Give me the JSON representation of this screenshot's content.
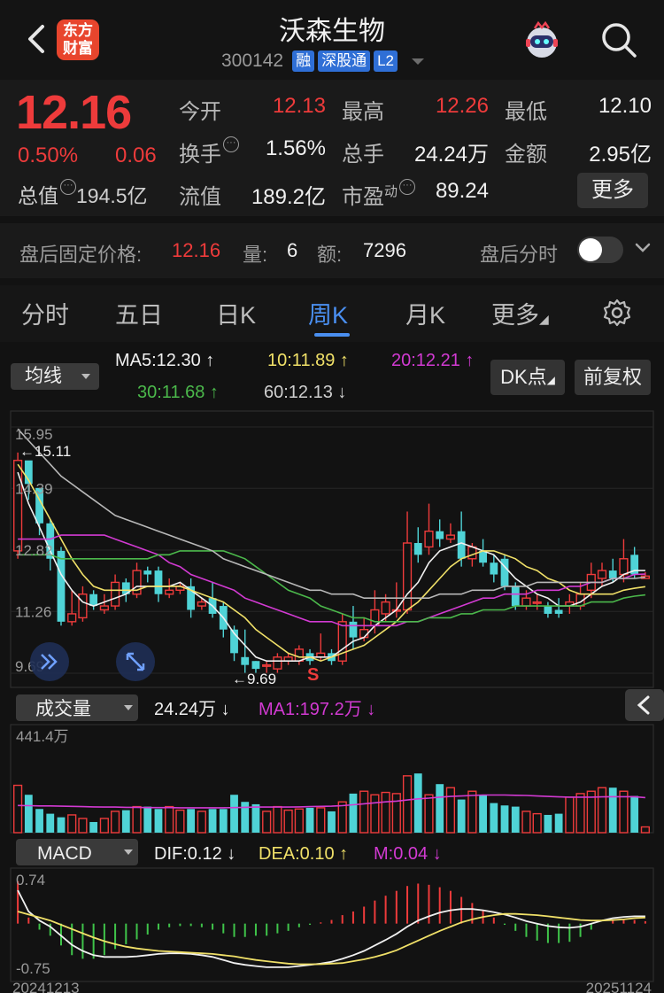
{
  "header": {
    "title": "沃森生物",
    "code": "300142",
    "badges": [
      "融",
      "深股通",
      "L2"
    ],
    "logo_line1": "东方",
    "logo_line2": "财富"
  },
  "quote": {
    "price": "12.16",
    "change_pct": "0.50%",
    "change": "0.06",
    "rows": [
      [
        {
          "label": "今开",
          "value": "12.13",
          "color": "red"
        },
        {
          "label": "最高",
          "value": "12.26",
          "color": "red"
        },
        {
          "label": "最低",
          "value": "12.10",
          "color": "white"
        }
      ],
      [
        {
          "label": "换手",
          "value": "1.56%",
          "color": "white"
        },
        {
          "label": "总手",
          "value": "24.24万",
          "color": "white"
        },
        {
          "label": "金额",
          "value": "2.95亿",
          "color": "white"
        }
      ],
      [
        {
          "label": "流值",
          "value": "189.2亿",
          "color": "white"
        },
        {
          "label": "市盈",
          "value": "89.24",
          "color": "white"
        }
      ]
    ],
    "total_mv_label": "总值",
    "total_mv_value": "194.5亿",
    "pe_superscript": "动",
    "more_label": "更多"
  },
  "after_hours": {
    "label": "盘后固定价格:",
    "price": "12.16",
    "vol_label": "量:",
    "vol": "6",
    "amt_label": "额:",
    "amt": "7296",
    "timeshare_label": "盘后分时"
  },
  "tabs": [
    "分时",
    "五日",
    "日K",
    "周K",
    "月K",
    "更多"
  ],
  "active_tab": "周K",
  "indicators": {
    "ma_selector": "均线",
    "ma5": "MA5:12.30 ↑",
    "ma10": "10:11.89 ↑",
    "ma20": "20:12.21 ↑",
    "ma30": "30:11.68 ↑",
    "ma60": "60:12.13 ↓",
    "dk_label": "DK点",
    "fq_label": "前复权",
    "vol_selector": "成交量",
    "vol_value": "24.24万 ↓",
    "vol_ma1": "MA1:197.2万 ↓",
    "macd_selector": "MACD",
    "dif": "DIF:0.12 ↓",
    "dea": "DEA:0.10 ↑",
    "m": "M:0.04 ↓"
  },
  "colors": {
    "up": "#ee3b3b",
    "down": "#4fd3d6",
    "ma5": "#f0f0f0",
    "ma10": "#f0e068",
    "ma20": "#d23ad2",
    "ma30": "#4bb84b",
    "ma60": "#b8b8b8",
    "accent": "#4a8ff0"
  },
  "chart_data": [
    {
      "type": "candlestick",
      "title": "",
      "y_tick_labels": [
        "15.95",
        "14.39",
        "12.82",
        "11.26",
        "9.69"
      ],
      "ylim": [
        9.69,
        15.95
      ],
      "annotations": [
        "←15.11",
        "←9.69",
        "S"
      ],
      "candles": [
        [
          12.8,
          15.1,
          15.3,
          12.6
        ],
        [
          15.1,
          14.5,
          15.0,
          14.1
        ],
        [
          14.4,
          13.5,
          14.4,
          13.2
        ],
        [
          13.5,
          12.6,
          13.6,
          12.3
        ],
        [
          12.8,
          11.0,
          12.9,
          10.9
        ],
        [
          11.0,
          11.2,
          11.8,
          10.9
        ],
        [
          11.1,
          11.7,
          11.9,
          11.0
        ],
        [
          11.7,
          11.4,
          11.8,
          11.3
        ],
        [
          11.3,
          11.4,
          11.7,
          11.2
        ],
        [
          11.4,
          12.0,
          12.2,
          11.3
        ],
        [
          12.0,
          11.7,
          12.1,
          11.5
        ],
        [
          11.7,
          12.3,
          12.5,
          11.6
        ],
        [
          12.3,
          12.2,
          12.4,
          12.0
        ],
        [
          12.3,
          11.7,
          12.4,
          11.5
        ],
        [
          11.7,
          11.8,
          12.1,
          11.6
        ],
        [
          11.8,
          11.9,
          12.0,
          11.7
        ],
        [
          11.9,
          11.3,
          12.1,
          11.1
        ],
        [
          11.4,
          11.5,
          11.6,
          11.3
        ],
        [
          11.6,
          11.2,
          12.0,
          11.1
        ],
        [
          11.4,
          10.8,
          11.5,
          10.6
        ],
        [
          10.8,
          10.2,
          10.9,
          10.0
        ],
        [
          10.1,
          9.9,
          10.8,
          9.7
        ],
        [
          10.0,
          9.8,
          10.0,
          9.7
        ],
        [
          9.9,
          9.9,
          10.0,
          9.7
        ],
        [
          9.8,
          10.1,
          10.2,
          9.7
        ],
        [
          10.0,
          10.1,
          10.2,
          9.9
        ],
        [
          10.0,
          10.3,
          10.4,
          9.9
        ],
        [
          10.2,
          10.0,
          10.3,
          9.9
        ],
        [
          10.1,
          10.2,
          10.7,
          10.0
        ],
        [
          10.2,
          10.0,
          10.3,
          9.9
        ],
        [
          10.0,
          11.0,
          11.2,
          9.9
        ],
        [
          11.0,
          10.6,
          11.4,
          10.3
        ],
        [
          10.6,
          10.8,
          11.1,
          10.5
        ],
        [
          10.9,
          11.3,
          11.8,
          10.7
        ],
        [
          11.2,
          11.5,
          11.7,
          11.0
        ],
        [
          11.3,
          11.3,
          12.0,
          11.1
        ],
        [
          11.3,
          13.0,
          13.8,
          11.2
        ],
        [
          13.0,
          12.7,
          13.4,
          12.5
        ],
        [
          12.9,
          13.3,
          14.0,
          12.7
        ],
        [
          13.3,
          13.1,
          13.6,
          12.9
        ],
        [
          13.1,
          13.2,
          13.5,
          13.0
        ],
        [
          13.3,
          12.6,
          13.8,
          12.4
        ],
        [
          12.6,
          12.9,
          13.0,
          12.4
        ],
        [
          12.8,
          12.5,
          13.1,
          12.4
        ],
        [
          12.5,
          12.2,
          12.7,
          12.0
        ],
        [
          12.6,
          11.9,
          12.7,
          11.8
        ],
        [
          11.9,
          11.4,
          12.0,
          11.3
        ],
        [
          11.4,
          11.6,
          11.8,
          11.3
        ],
        [
          11.5,
          11.5,
          11.7,
          11.3
        ],
        [
          11.4,
          11.2,
          11.5,
          11.1
        ],
        [
          11.3,
          11.2,
          11.6,
          11.1
        ],
        [
          11.4,
          11.5,
          11.7,
          11.2
        ],
        [
          11.4,
          11.7,
          12.0,
          11.3
        ],
        [
          11.8,
          12.2,
          12.5,
          11.6
        ],
        [
          12.1,
          12.3,
          12.5,
          11.9
        ],
        [
          12.3,
          12.1,
          12.6,
          12.0
        ],
        [
          12.2,
          12.6,
          13.1,
          12.0
        ],
        [
          12.7,
          12.2,
          12.9,
          12.1
        ],
        [
          12.1,
          12.16,
          12.26,
          12.1
        ]
      ],
      "ma_lines": {
        "MA5": [
          14.8,
          14.0,
          13.4,
          12.8,
          12.2,
          11.8,
          11.5,
          11.4,
          11.5,
          11.6,
          11.7,
          11.9,
          11.9,
          11.9,
          11.9,
          12.0,
          11.8,
          11.6,
          11.4,
          11.1,
          10.7,
          10.4,
          10.1,
          10.0,
          10.0,
          10.0,
          10.0,
          10.1,
          10.1,
          10.1,
          10.3,
          10.5,
          10.6,
          10.9,
          11.1,
          11.3,
          11.7,
          12.0,
          12.5,
          12.8,
          12.9,
          13.0,
          12.9,
          12.8,
          12.7,
          12.4,
          12.1,
          11.9,
          11.7,
          11.6,
          11.4,
          11.4,
          11.5,
          11.7,
          11.9,
          12.0,
          12.2,
          12.3,
          12.3
        ],
        "MA10": [
          15.0,
          14.6,
          14.1,
          13.6,
          13.1,
          12.6,
          12.2,
          11.9,
          11.8,
          11.8,
          11.8,
          11.8,
          11.9,
          11.9,
          11.9,
          11.9,
          11.8,
          11.7,
          11.6,
          11.5,
          11.3,
          11.1,
          10.8,
          10.6,
          10.4,
          10.2,
          10.1,
          10.1,
          10.0,
          10.1,
          10.2,
          10.3,
          10.4,
          10.6,
          10.8,
          11.0,
          11.3,
          11.5,
          11.8,
          12.1,
          12.4,
          12.6,
          12.7,
          12.8,
          12.8,
          12.7,
          12.6,
          12.4,
          12.3,
          12.1,
          12.0,
          11.8,
          11.7,
          11.7,
          11.7,
          11.7,
          11.8,
          11.85,
          11.89
        ],
        "MA20": [
          13.1,
          13.1,
          13.1,
          13.1,
          13.2,
          13.2,
          13.2,
          13.2,
          13.2,
          13.1,
          13.0,
          12.9,
          12.8,
          12.7,
          12.5,
          12.4,
          12.2,
          12.1,
          12.0,
          11.9,
          11.8,
          11.6,
          11.5,
          11.4,
          11.3,
          11.2,
          11.1,
          11.0,
          11.0,
          11.0,
          10.9,
          10.9,
          10.9,
          10.9,
          10.9,
          10.9,
          11.0,
          11.0,
          11.1,
          11.2,
          11.3,
          11.4,
          11.5,
          11.6,
          11.6,
          11.7,
          11.7,
          11.7,
          11.8,
          11.8,
          11.8,
          11.9,
          11.9,
          12.0,
          12.0,
          12.1,
          12.1,
          12.2,
          12.21
        ],
        "MA30": [
          12.7,
          12.7,
          12.7,
          12.7,
          12.6,
          12.6,
          12.6,
          12.6,
          12.6,
          12.6,
          12.6,
          12.6,
          12.6,
          12.7,
          12.7,
          12.8,
          12.8,
          12.8,
          12.8,
          12.8,
          12.7,
          12.6,
          12.4,
          12.2,
          12.0,
          11.8,
          11.7,
          11.6,
          11.4,
          11.3,
          11.2,
          11.1,
          11.1,
          11.0,
          11.0,
          11.0,
          11.0,
          11.0,
          11.1,
          11.1,
          11.1,
          11.2,
          11.2,
          11.3,
          11.3,
          11.3,
          11.4,
          11.4,
          11.4,
          11.4,
          11.4,
          11.4,
          11.4,
          11.5,
          11.5,
          11.5,
          11.6,
          11.65,
          11.68
        ],
        "MA60": [
          15.9,
          15.6,
          15.3,
          15.0,
          14.7,
          14.5,
          14.3,
          14.1,
          13.9,
          13.7,
          13.6,
          13.5,
          13.4,
          13.3,
          13.2,
          13.1,
          13.0,
          12.9,
          12.8,
          12.6,
          12.5,
          12.4,
          12.3,
          12.2,
          12.1,
          12.0,
          11.9,
          11.8,
          11.8,
          11.7,
          11.7,
          11.7,
          11.6,
          11.6,
          11.6,
          11.6,
          11.6,
          11.6,
          11.6,
          11.7,
          11.7,
          11.7,
          11.8,
          11.8,
          11.8,
          11.9,
          11.9,
          11.9,
          12.0,
          12.0,
          12.0,
          12.0,
          12.0,
          12.0,
          12.0,
          12.1,
          12.1,
          12.1,
          12.13
        ]
      }
    },
    {
      "type": "bar",
      "title": "",
      "y_tick_labels": [
        "441.4万"
      ],
      "ylim": [
        0,
        441.4
      ],
      "unit": "万",
      "values": [
        200,
        160,
        100,
        80,
        65,
        75,
        60,
        45,
        60,
        90,
        95,
        110,
        110,
        100,
        110,
        95,
        100,
        90,
        100,
        100,
        160,
        130,
        120,
        90,
        110,
        95,
        100,
        105,
        105,
        90,
        130,
        165,
        175,
        160,
        170,
        165,
        240,
        250,
        160,
        205,
        190,
        140,
        175,
        160,
        125,
        115,
        110,
        90,
        80,
        75,
        80,
        150,
        165,
        175,
        190,
        190,
        175,
        155,
        24.24
      ],
      "ma1": [
        115,
        114,
        113,
        113,
        112,
        111,
        110,
        109,
        108,
        108,
        107,
        107,
        106,
        106,
        106,
        105,
        105,
        105,
        105,
        105,
        106,
        107,
        108,
        108,
        108,
        108,
        109,
        110,
        111,
        112,
        114,
        118,
        122,
        126,
        130,
        133,
        138,
        143,
        146,
        150,
        153,
        155,
        157,
        159,
        159,
        159,
        158,
        157,
        155,
        153,
        151,
        150,
        150,
        150,
        151,
        152,
        152,
        152,
        148
      ]
    },
    {
      "type": "line",
      "title": "",
      "y_tick_labels": [
        "0.74",
        "-0.75"
      ],
      "x_tick_labels": [
        "20241213",
        "20251124"
      ],
      "ylim": [
        -0.75,
        0.74
      ],
      "series": [
        {
          "name": "DIF",
          "values": [
            0.55,
            0.2,
            0.05,
            -0.05,
            -0.2,
            -0.35,
            -0.45,
            -0.52,
            -0.55,
            -0.55,
            -0.55,
            -0.54,
            -0.52,
            -0.5,
            -0.49,
            -0.49,
            -0.5,
            -0.52,
            -0.55,
            -0.6,
            -0.65,
            -0.68,
            -0.7,
            -0.72,
            -0.72,
            -0.72,
            -0.7,
            -0.68,
            -0.66,
            -0.63,
            -0.58,
            -0.52,
            -0.45,
            -0.36,
            -0.27,
            -0.17,
            -0.05,
            0.05,
            0.12,
            0.18,
            0.22,
            0.24,
            0.24,
            0.22,
            0.19,
            0.15,
            0.1,
            0.04,
            0.0,
            -0.04,
            -0.06,
            -0.07,
            -0.05,
            0.0,
            0.05,
            0.09,
            0.11,
            0.12,
            0.12
          ]
        },
        {
          "name": "DEA",
          "values": [
            0.2,
            0.15,
            0.1,
            0.05,
            -0.02,
            -0.09,
            -0.16,
            -0.23,
            -0.29,
            -0.34,
            -0.38,
            -0.41,
            -0.43,
            -0.45,
            -0.46,
            -0.47,
            -0.48,
            -0.49,
            -0.5,
            -0.52,
            -0.54,
            -0.57,
            -0.6,
            -0.62,
            -0.64,
            -0.66,
            -0.67,
            -0.67,
            -0.67,
            -0.66,
            -0.65,
            -0.62,
            -0.59,
            -0.55,
            -0.5,
            -0.44,
            -0.36,
            -0.28,
            -0.2,
            -0.12,
            -0.05,
            0.02,
            0.07,
            0.11,
            0.14,
            0.16,
            0.16,
            0.15,
            0.14,
            0.12,
            0.1,
            0.08,
            0.06,
            0.05,
            0.05,
            0.06,
            0.07,
            0.09,
            0.1
          ]
        },
        {
          "name": "M",
          "values": [
            0.7,
            0.1,
            -0.1,
            -0.2,
            -0.36,
            -0.52,
            -0.58,
            -0.58,
            -0.52,
            -0.42,
            -0.34,
            -0.26,
            -0.18,
            -0.1,
            -0.06,
            -0.04,
            -0.04,
            -0.06,
            -0.1,
            -0.16,
            -0.22,
            -0.22,
            -0.2,
            -0.2,
            -0.16,
            -0.12,
            -0.06,
            -0.02,
            0.02,
            0.06,
            0.14,
            0.2,
            0.28,
            0.38,
            0.46,
            0.54,
            0.62,
            0.66,
            0.64,
            0.6,
            0.54,
            0.44,
            0.34,
            0.22,
            0.1,
            -0.02,
            -0.12,
            -0.22,
            -0.28,
            -0.32,
            -0.32,
            -0.3,
            -0.22,
            -0.1,
            0.0,
            0.06,
            0.08,
            0.06,
            0.04
          ]
        }
      ]
    }
  ]
}
